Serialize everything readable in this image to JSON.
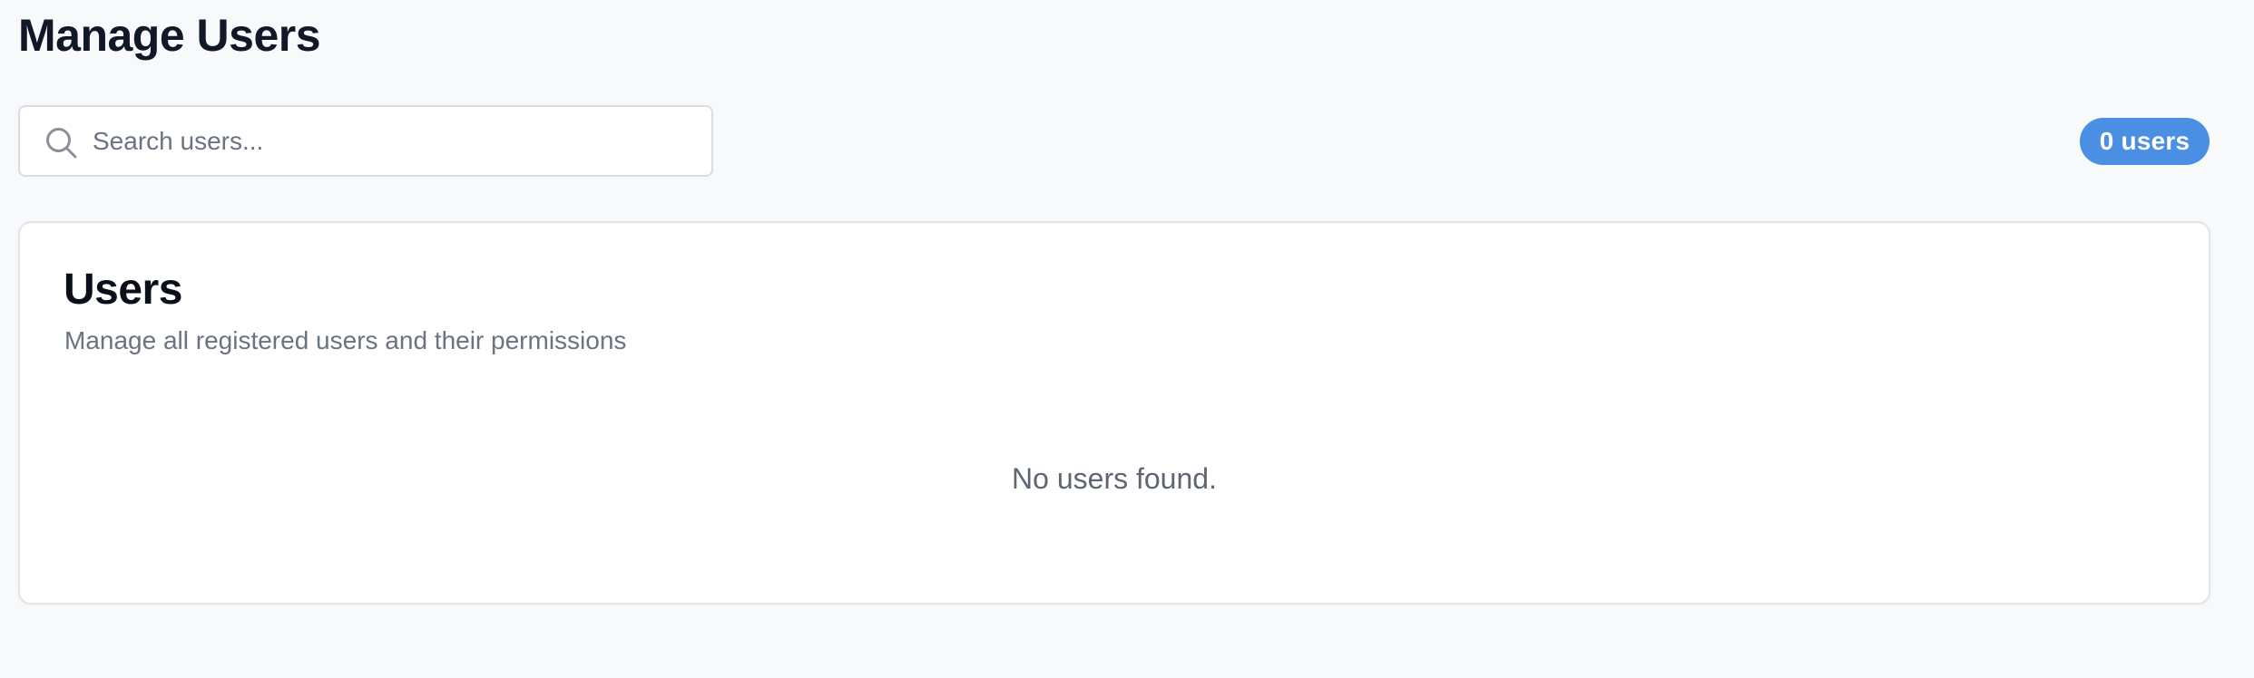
{
  "page": {
    "title": "Manage Users"
  },
  "search": {
    "placeholder": "Search users...",
    "value": "",
    "icon": "search-icon"
  },
  "user_count_badge": {
    "label": "0 users",
    "color": "#4a8fe3"
  },
  "users_card": {
    "title": "Users",
    "subtitle": "Manage all registered users and their permissions",
    "empty_message": "No users found."
  }
}
